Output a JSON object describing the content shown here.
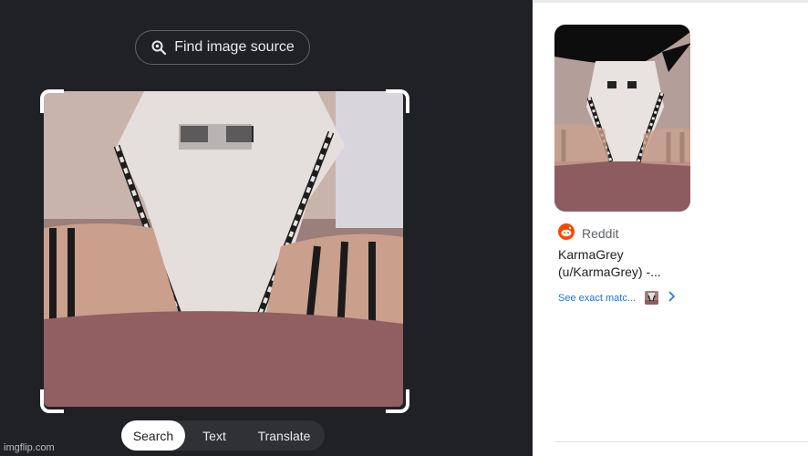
{
  "lens": {
    "find_source_label": "Find image source",
    "modes": [
      "Search",
      "Text",
      "Translate"
    ],
    "active_mode": "Search"
  },
  "watermark": "imgflip.com",
  "result": {
    "source_name": "Reddit",
    "title": "KarmaGrey (u/KarmaGrey) -...",
    "exact_match_label": "See exact matc..."
  },
  "colors": {
    "dark_panel": "#202124",
    "accent_link": "#1a73e8",
    "reddit_orange": "#ff4500"
  },
  "icons": {
    "find_source": "lens-search-icon",
    "source": "reddit-icon",
    "chevron": "chevron-right-icon"
  }
}
